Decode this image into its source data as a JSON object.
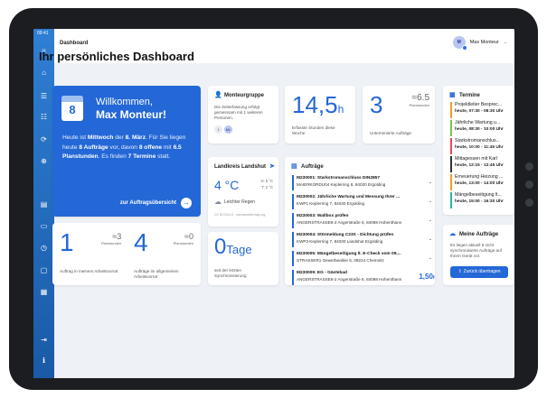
{
  "status_time": "09:41",
  "topbar": {
    "crumb": "Dashboard",
    "user_initials": "M",
    "user_name": "Max Monteur"
  },
  "page_title": "Ihr persönliches Dashboard",
  "welcome": {
    "day_number": "8",
    "greeting": "Willkommen,",
    "name": "Max Monteur!",
    "line1": "Heute ist ",
    "weekday": "Mittwoch",
    "line2": " der ",
    "date": "8. März",
    "line3": ". Für Sie liegen heute ",
    "orders": "8 Aufträge",
    "line4": " vor, davon ",
    "open": "8 offene",
    "line5": " mit ",
    "hours": "6.5 Planstunden",
    "line6": ". Es finden ",
    "appts": "7 Termine",
    "line7": " statt.",
    "link": "zur Auftragsübersicht"
  },
  "team": {
    "title": "Monteurgruppe",
    "text": "Die Zeiterfassung erfolgt gemeinsam mit 1 weiteren Personen.",
    "avatar1": "1",
    "avatar2": "ML"
  },
  "hours_card": {
    "value": "14,5",
    "unit": "h",
    "caption": "Erfasste Stunden diese Woche"
  },
  "open_card": {
    "value": "3",
    "approx": "≈6.5",
    "approx_label": "Planstunden",
    "caption": "Unterminierte Aufträge"
  },
  "weather": {
    "title": "Landkreis Landshut",
    "temp": "4 °C",
    "high": "H: 5 °C",
    "low": "T: 2 °C",
    "desc": "Leichter Regen",
    "credit": "CC BY-SA 4.0 · openweathermap.org"
  },
  "orders_card": {
    "title": "Aufträge",
    "items": [
      {
        "l1": "M230001: Starkstromanschluss DIN2857",
        "l2": "MAIERKORDU04 Keplerring 8, 84030 Ergolding"
      },
      {
        "l1": "M230002: Jährliche Wartung und Messung Ihrer ...",
        "l2": "KWP1 Keplerring 7, 84030 Ergolding"
      },
      {
        "l1": "M230003: Wallbox prüfen",
        "l2": "ANGERSTRASSE6-2 Angerstraße 6, 84098 Hohenthann"
      },
      {
        "l1": "M230004: Störmeldung C23X - Dichtung prüfen",
        "l2": "KWP3 Keplerring 7, 84030 Landshut Ergolding"
      },
      {
        "l1": "M230005: Mängelbeseitigung lt. E-Check vom 09....",
        "l2": "STRASSER1 Gewerbeallee 5, 09224 Chemnitz"
      },
      {
        "l1": "M230009: EG - Gästebad",
        "l2": "ANGERSTRASSE6-2 Angerstraße 6, 84098 Hohenthann",
        "badge": "1,50",
        "badge_unit": "h"
      }
    ]
  },
  "termine": {
    "title": "Termine",
    "items": [
      {
        "t": "Projektleiter Bespreс...",
        "time": "heute, 07:30 - 08:30 Uhr",
        "color": "#f0a020"
      },
      {
        "t": "Jährliche Wartung u...",
        "time": "heute, 08:30 - 10:00 Uhr",
        "color": "#7cc243"
      },
      {
        "t": "Starkstromanschlus...",
        "time": "heute, 10:00 - 11:45 Uhr",
        "color": "#e8485a"
      },
      {
        "t": "Mittagessen mit Karl",
        "time": "heute, 12:15 - 12:45 Uhr",
        "color": "#333333"
      },
      {
        "t": "Erneuerung Heizung ...",
        "time": "heute, 13:00 - 14:00 Uhr",
        "color": "#f0a020"
      },
      {
        "t": "Mängelbeseitigung lt...",
        "time": "heute, 15:00 - 16:30 Uhr",
        "color": "#2bb3a4"
      }
    ]
  },
  "month_card": {
    "value": "1",
    "approx": "≈3",
    "approx_label": "Planstunden",
    "caption": "Auftrag in meinem Arbeitsvorrat"
  },
  "general_card": {
    "value": "4",
    "approx": "≈0",
    "approx_label": "Planstunden",
    "caption": "Aufträge im allgemeinen Arbeitsvorrat"
  },
  "days_card": {
    "value": "0",
    "unit": "Tage",
    "caption": "seit der letzten Synchronisierung"
  },
  "meine": {
    "title": "Meine Aufträge",
    "text": "Es liegen aktuell 8 nicht synchronisierte Aufträge auf Ihrem Gerät vor.",
    "button": "Zurück übertragen"
  }
}
